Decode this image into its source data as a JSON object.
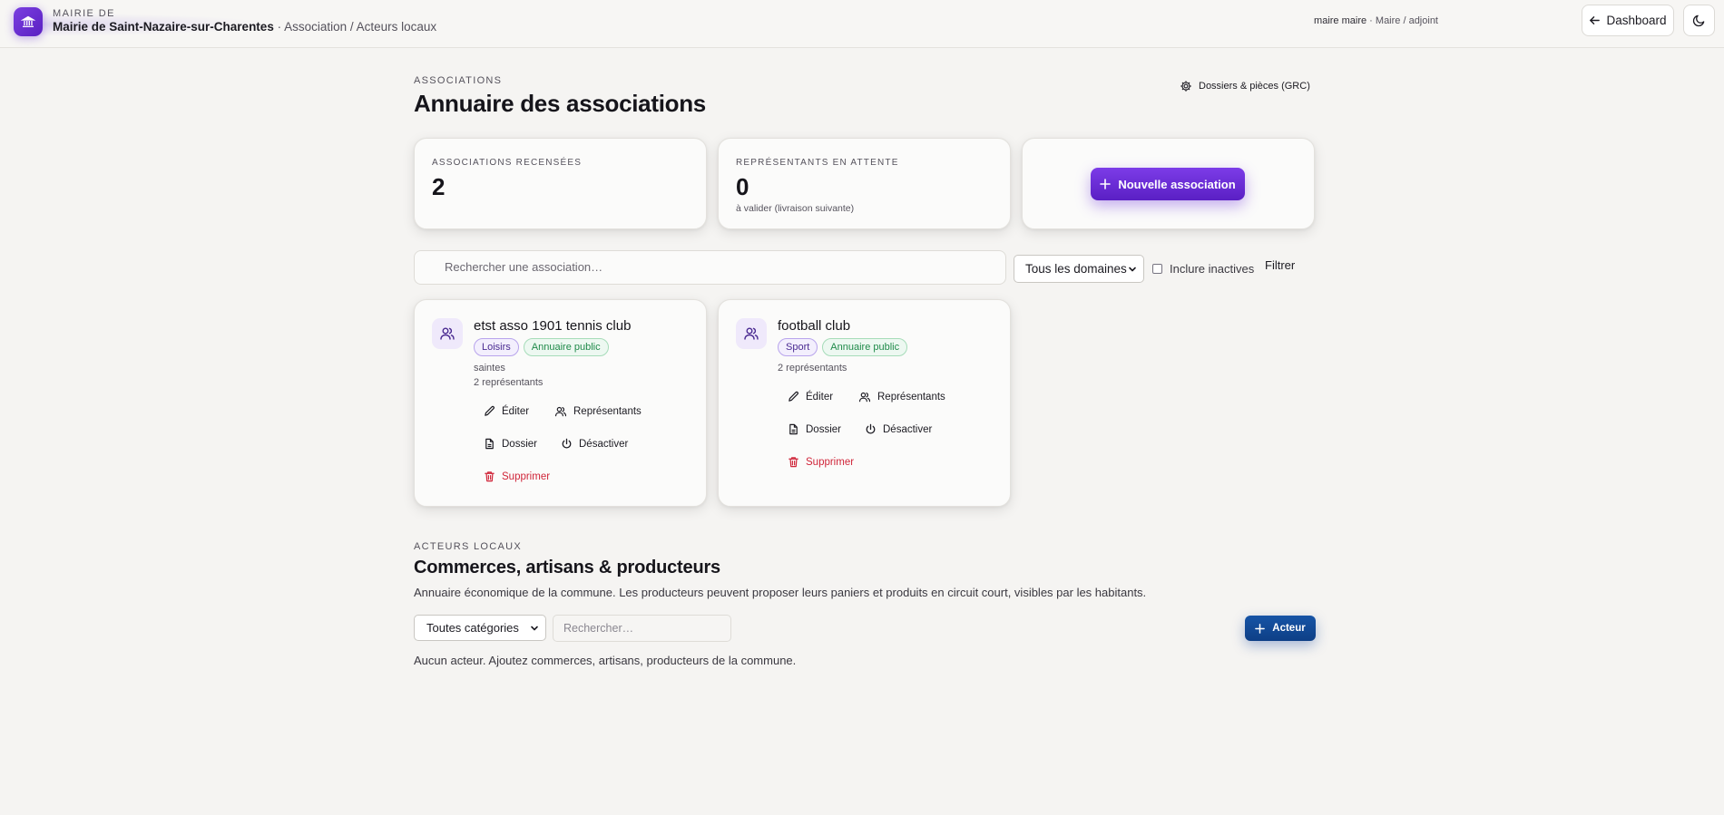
{
  "header": {
    "kicker": "MAIRIE DE",
    "town": "Mairie de Saint-Nazaire-sur-Charentes",
    "breadcrumb": " · Association / Acteurs locaux",
    "user_name": "maire maire",
    "user_role": " · Maire / adjoint",
    "dashboard_label": "Dashboard",
    "logo_icon": "town-hall-icon",
    "theme_icon": "moon-icon"
  },
  "associations": {
    "kicker": "ASSOCIATIONS",
    "title": "Annuaire des associations",
    "grc_link": "Dossiers & pièces (GRC)",
    "stats": {
      "count_label": "ASSOCIATIONS RECENSÉES",
      "count_value": "2",
      "pending_label": "REPRÉSENTANTS EN ATTENTE",
      "pending_value": "0",
      "pending_sub": "à valider (livraison suivante)"
    },
    "new_button": "Nouvelle association",
    "search_placeholder": "Rechercher une association…",
    "domain_select": "Tous les domaines",
    "include_inactive": "Inclure inactives",
    "filter_button": "Filtrer",
    "items": [
      {
        "name": "etst asso 1901 tennis club",
        "badges": [
          "Loisirs",
          "Annuaire public"
        ],
        "city": "saintes",
        "reps": "2 représentants"
      },
      {
        "name": "football club",
        "badges": [
          "Sport",
          "Annuaire public"
        ],
        "reps": "2 représentants"
      }
    ],
    "actions": {
      "edit": "Éditer",
      "reps": "Représentants",
      "folder": "Dossier",
      "deactivate": "Désactiver",
      "delete": "Supprimer"
    }
  },
  "actors": {
    "kicker": "ACTEURS LOCAUX",
    "title": "Commerces, artisans & producteurs",
    "description": "Annuaire économique de la commune. Les producteurs peuvent proposer leurs paniers et produits en circuit court, visibles par les habitants.",
    "category_select": "Toutes catégories",
    "search_placeholder": "Rechercher…",
    "add_button": "Acteur",
    "empty_text": "Aucun acteur. Ajoutez commerces, artisans, producteurs de la commune."
  },
  "colors": {
    "accent_purple": "#6a2ed6",
    "accent_blue": "#124a98",
    "danger": "#d0263a",
    "badge_green": "#1f8a49"
  }
}
